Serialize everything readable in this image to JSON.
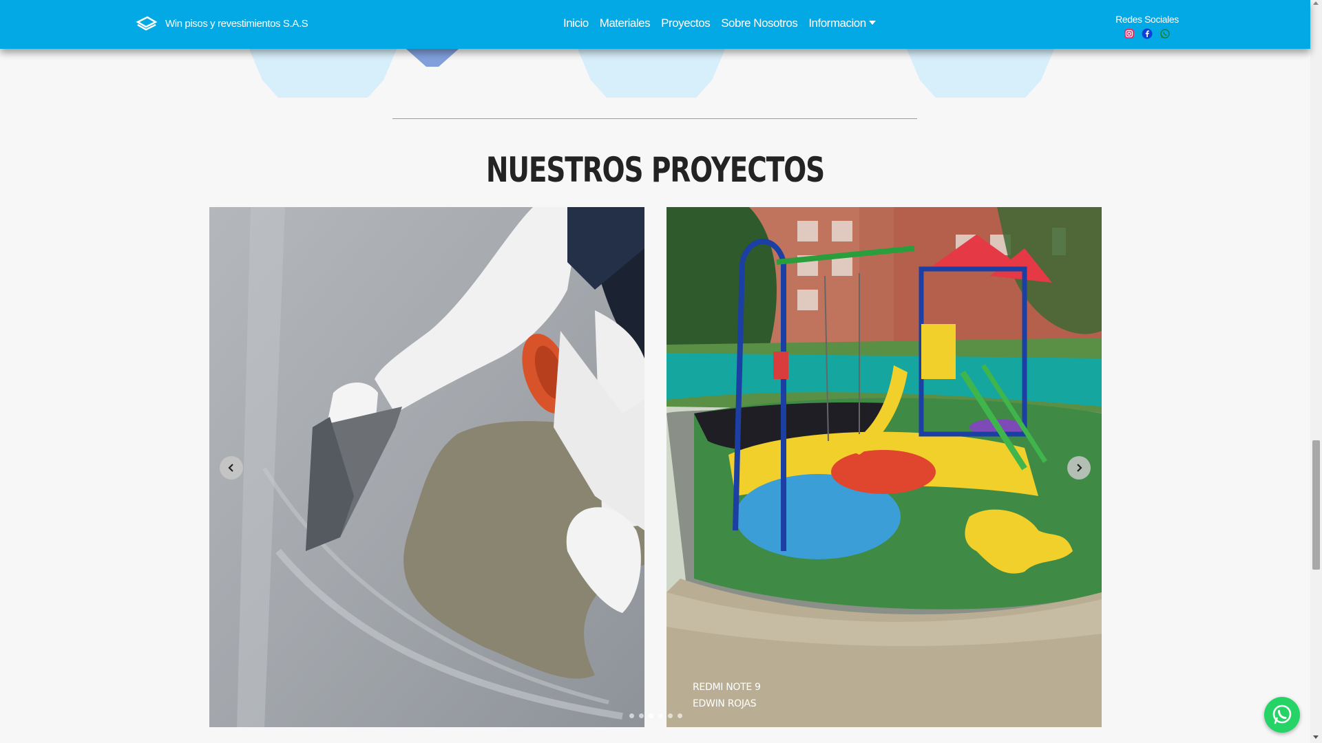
{
  "navbar": {
    "brand_name": "Win pisos y revestimientos S.A.S",
    "links": [
      {
        "label": "Inicio"
      },
      {
        "label": "Materiales"
      },
      {
        "label": "Proyectos"
      },
      {
        "label": "Sobre Nosotros"
      },
      {
        "label": "Informacion"
      }
    ],
    "social": {
      "title": "Redes Sociales",
      "icons": [
        "instagram-icon",
        "facebook-icon",
        "whatsapp-icon"
      ]
    }
  },
  "projects": {
    "title": "NUESTROS PROYECTOS",
    "slides": [
      {
        "image": "epoxy-floor-application-photo"
      },
      {
        "image": "playground-rubber-floor-photo"
      }
    ],
    "watermark_line1": "REDMI NOTE 9",
    "watermark_line2": "EDWIN ROJAS",
    "indicator_count": 6,
    "active_indicator": 3
  },
  "colors": {
    "navbar": "#03a9e4",
    "title": "#232323",
    "whatsapp": "#25d366"
  }
}
